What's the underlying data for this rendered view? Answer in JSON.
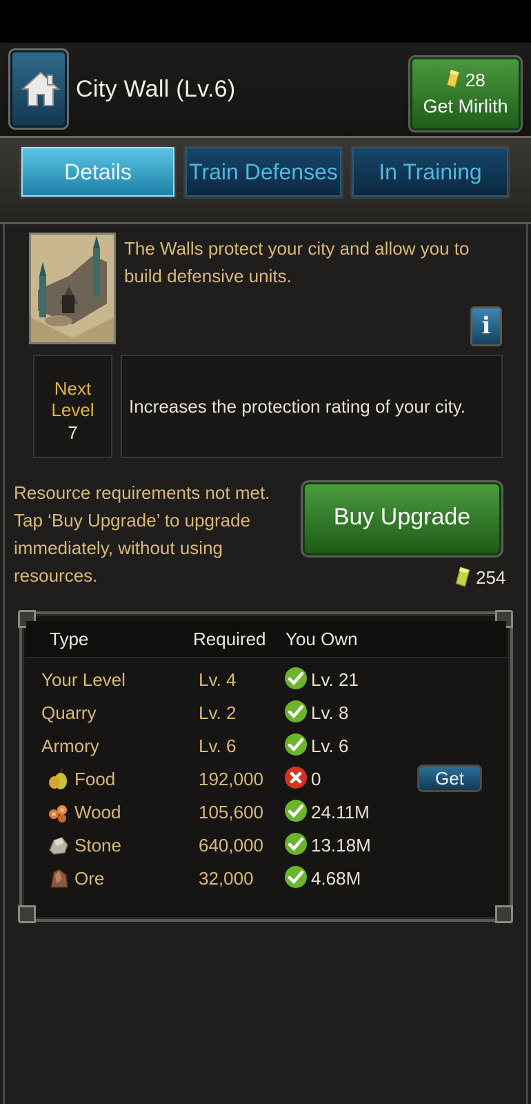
{
  "header": {
    "title": "City Wall (Lv.6)",
    "mirlith_count": "28",
    "mirlith_button_label": "Get Mirlith"
  },
  "tabs": [
    {
      "label": "Details",
      "active": true
    },
    {
      "label": "Train Defenses",
      "active": false
    },
    {
      "label": "In Training",
      "active": false
    }
  ],
  "details": {
    "description": "The Walls protect your city and allow you to build defensive units.",
    "next_level_label": "Next Level",
    "next_level_value": "7",
    "next_level_effect": "Increases the protection rating of your city.",
    "requirements_message": "Resource requirements not met. Tap ‘Buy Upgrade’ to upgrade immediately, without using resources.",
    "buy_button_label": "Buy Upgrade",
    "buy_cost": "254"
  },
  "requirements_table": {
    "headers": {
      "type": "Type",
      "required": "Required",
      "owned": "You Own"
    },
    "rows": [
      {
        "type": "Your Level",
        "required": "Lv. 4",
        "owned": "Lv. 21",
        "met": true,
        "icon": "none"
      },
      {
        "type": "Quarry",
        "required": "Lv. 2",
        "owned": "Lv. 8",
        "met": true,
        "icon": "none"
      },
      {
        "type": "Armory",
        "required": "Lv. 6",
        "owned": "Lv. 6",
        "met": true,
        "icon": "none"
      },
      {
        "type": "Food",
        "required": "192,000",
        "owned": "0",
        "met": false,
        "icon": "food-icon"
      },
      {
        "type": "Wood",
        "required": "105,600",
        "owned": "24.11M",
        "met": true,
        "icon": "wood-icon"
      },
      {
        "type": "Stone",
        "required": "640,000",
        "owned": "13.18M",
        "met": true,
        "icon": "stone-icon"
      },
      {
        "type": "Ore",
        "required": "32,000",
        "owned": "4.68M",
        "met": true,
        "icon": "ore-icon"
      }
    ],
    "get_button_label": "Get"
  },
  "colors": {
    "accent_gold": "#d8b878",
    "next_level_gold": "#e2b43c",
    "tab_active": "#5bc7e6",
    "button_green": "#4c9e40",
    "check_green": "#6ab52c",
    "cross_red": "#d8321e"
  }
}
